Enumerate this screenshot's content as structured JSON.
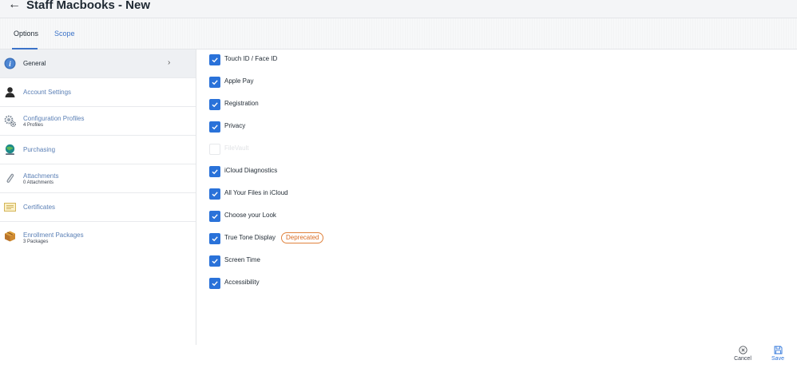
{
  "header": {
    "back_icon": "arrow-left-icon",
    "back_glyph": "←",
    "title": "Staff Macbooks - New"
  },
  "tabs": [
    {
      "label": "Options",
      "active": true
    },
    {
      "label": "Scope",
      "active": false
    }
  ],
  "sidebar": {
    "items": [
      {
        "label": "General",
        "sublabel": "",
        "icon": "info-icon",
        "active": true,
        "chevron": "›"
      },
      {
        "label": "Account Settings",
        "sublabel": "",
        "icon": "user-icon",
        "active": false
      },
      {
        "label": "Configuration Profiles",
        "sublabel": "4 Profiles",
        "icon": "gear-icon",
        "active": false
      },
      {
        "label": "Purchasing",
        "sublabel": "",
        "icon": "globe-icon",
        "active": false
      },
      {
        "label": "Attachments",
        "sublabel": "0 Attachments",
        "icon": "paperclip-icon",
        "active": false
      },
      {
        "label": "Certificates",
        "sublabel": "",
        "icon": "certificate-icon",
        "active": false
      },
      {
        "label": "Enrollment Packages",
        "sublabel": "3 Packages",
        "icon": "package-icon",
        "active": false
      }
    ]
  },
  "options": [
    {
      "label": "Touch ID / Face ID",
      "checked": true
    },
    {
      "label": "Apple Pay",
      "checked": true
    },
    {
      "label": "Registration",
      "checked": true
    },
    {
      "label": "Privacy",
      "checked": true
    },
    {
      "label": "FileVault",
      "checked": false,
      "disabled": true
    },
    {
      "label": "iCloud Diagnostics",
      "checked": true
    },
    {
      "label": "All Your Files in iCloud",
      "checked": true
    },
    {
      "label": "Choose your Look",
      "checked": true
    },
    {
      "label": "True Tone Display",
      "checked": true,
      "badge": "Deprecated"
    },
    {
      "label": "Screen Time",
      "checked": true
    },
    {
      "label": "Accessibility",
      "checked": true
    }
  ],
  "footer": {
    "cancel_label": "Cancel",
    "cancel_icon": "cancel-circle-icon",
    "save_label": "Save",
    "save_icon": "save-icon"
  },
  "colors": {
    "accent": "#2a72d9",
    "link": "#3c73c8",
    "badge": "#e0823d"
  }
}
